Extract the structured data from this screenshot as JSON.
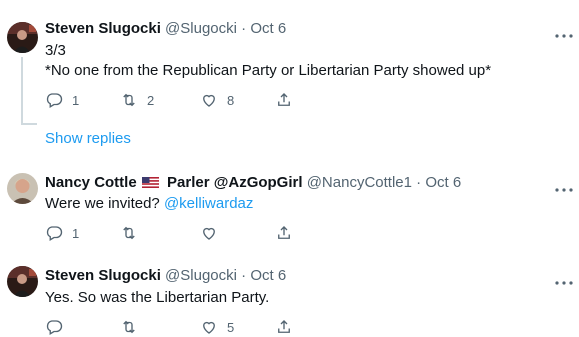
{
  "tweets": [
    {
      "name": "Steven Slugocki",
      "handle": "@Slugocki",
      "separator": "·",
      "date": "Oct 6",
      "lines": [
        "3/3",
        "*No one from the Republican Party or Libertarian Party showed up*"
      ],
      "reply_count": "1",
      "retweet_count": "2",
      "like_count": "8"
    },
    {
      "name_part1": "Nancy Cottle",
      "name_part2": "Parler @AzGopGirl",
      "handle": "@NancyCottle1",
      "separator": "·",
      "date": "Oct 6",
      "text": "Were we invited?",
      "mention": "@kelliwardaz",
      "reply_count": "1",
      "retweet_count": "",
      "like_count": ""
    },
    {
      "name": "Steven Slugocki",
      "handle": "@Slugocki",
      "separator": "·",
      "date": "Oct 6",
      "text": "Yes. So was the Libertarian Party.",
      "reply_count": "",
      "retweet_count": "",
      "like_count": "5"
    }
  ],
  "show_replies": "Show replies",
  "icons": {
    "reply": "reply-icon",
    "retweet": "retweet-icon",
    "like": "heart-icon",
    "share": "share-icon",
    "more": "more-icon",
    "flag": "us-flag-icon"
  },
  "colors": {
    "link": "#1d9bf0",
    "muted": "#536471",
    "text": "#0f1419"
  }
}
